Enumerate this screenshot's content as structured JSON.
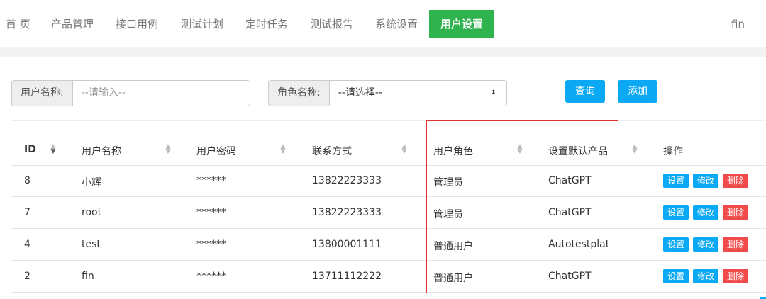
{
  "nav": {
    "items": [
      "首 页",
      "产品管理",
      "接口用例",
      "测试计划",
      "定时任务",
      "测试报告",
      "系统设置",
      "用户设置"
    ],
    "active_index": 7,
    "user": "fin"
  },
  "search": {
    "username_label": "用户名称:",
    "username_placeholder": "--请输入--",
    "role_label": "角色名称:",
    "role_selected": "--请选择--",
    "query_button": "查询",
    "add_button": "添加"
  },
  "table": {
    "columns": [
      "ID",
      "用户名称",
      "用户密码",
      "联系方式",
      "用户角色",
      "设置默认产品",
      "操作"
    ],
    "rows": [
      {
        "id": "8",
        "name": "小辉",
        "password": "******",
        "phone": "13822223333",
        "role": "管理员",
        "product": "ChatGPT"
      },
      {
        "id": "7",
        "name": "root",
        "password": "******",
        "phone": "13822223333",
        "role": "管理员",
        "product": "ChatGPT"
      },
      {
        "id": "4",
        "name": "test",
        "password": "******",
        "phone": "13800001111",
        "role": "普通用户",
        "product": "Autotestplat"
      },
      {
        "id": "2",
        "name": "fin",
        "password": "******",
        "phone": "13711112222",
        "role": "普通用户",
        "product": "ChatGPT"
      }
    ],
    "actions": {
      "set": "设置",
      "edit": "修改",
      "delete": "删除"
    }
  },
  "colors": {
    "nav_active": "#2eb34f",
    "primary": "#0ba9f3",
    "danger": "#f04a4a",
    "highlight": "#e03030"
  }
}
